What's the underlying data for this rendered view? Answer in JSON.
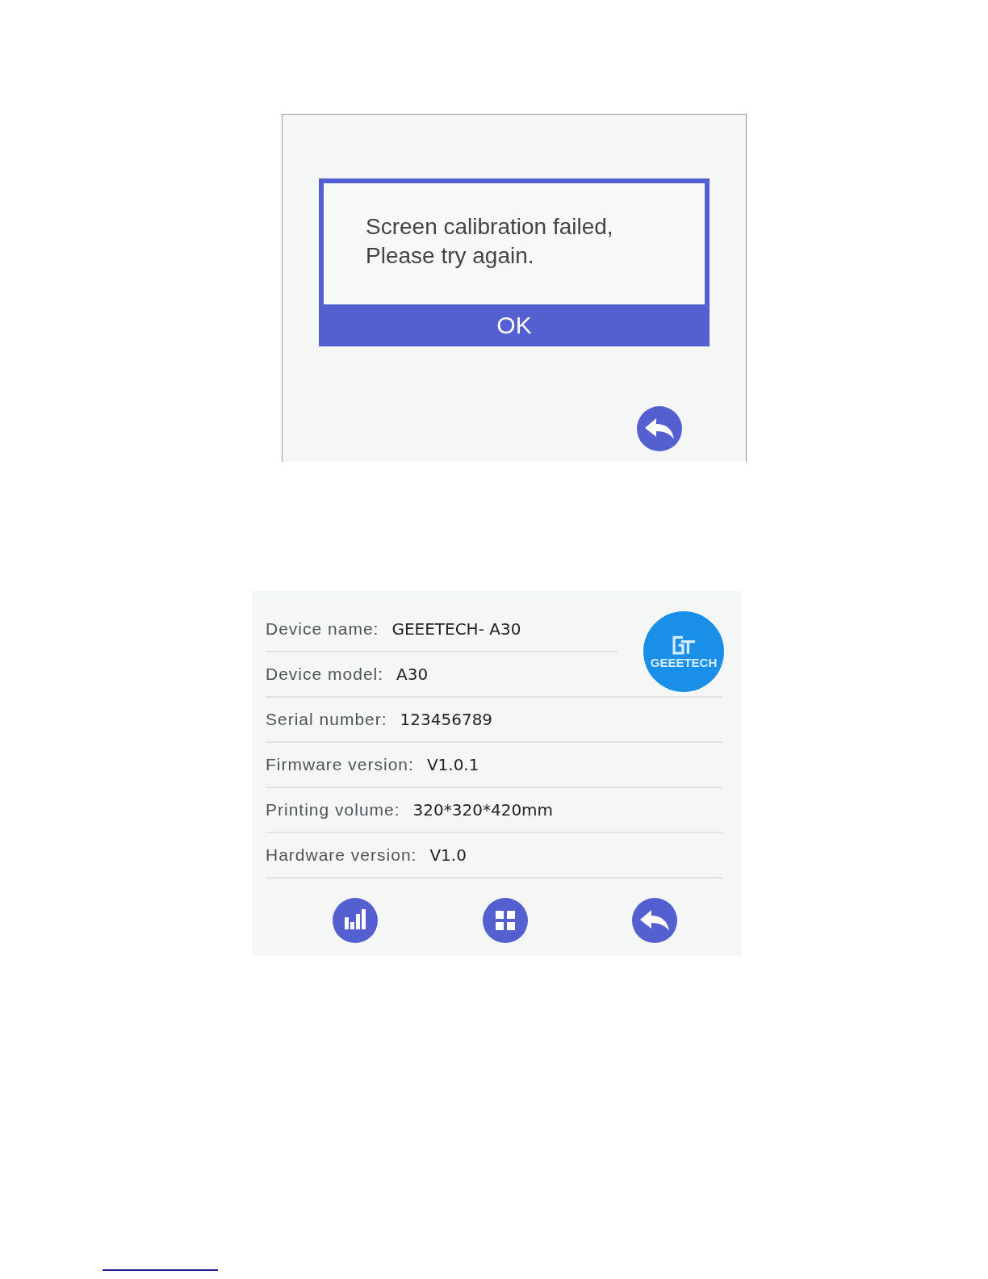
{
  "calibration_screen": {
    "dialog": {
      "message": "Screen calibration failed,\nPlease try again.",
      "button": "OK"
    }
  },
  "device_info_screen": {
    "fields": [
      {
        "label": "Device name:",
        "value": "GEEETECH- A30"
      },
      {
        "label": "Device model:",
        "value": "A30"
      },
      {
        "label": "Serial number:",
        "value": "123456789"
      },
      {
        "label": "Firmware version:",
        "value": "V1.0.1"
      },
      {
        "label": "Printing volume:",
        "value": "320*320*420mm"
      },
      {
        "label": "Hardware version:",
        "value": "V1.0"
      }
    ],
    "logo": {
      "text": "GEEETECH"
    },
    "toolbar": [
      {
        "kind": "chart"
      },
      {
        "kind": "grid"
      },
      {
        "kind": "back"
      }
    ]
  }
}
